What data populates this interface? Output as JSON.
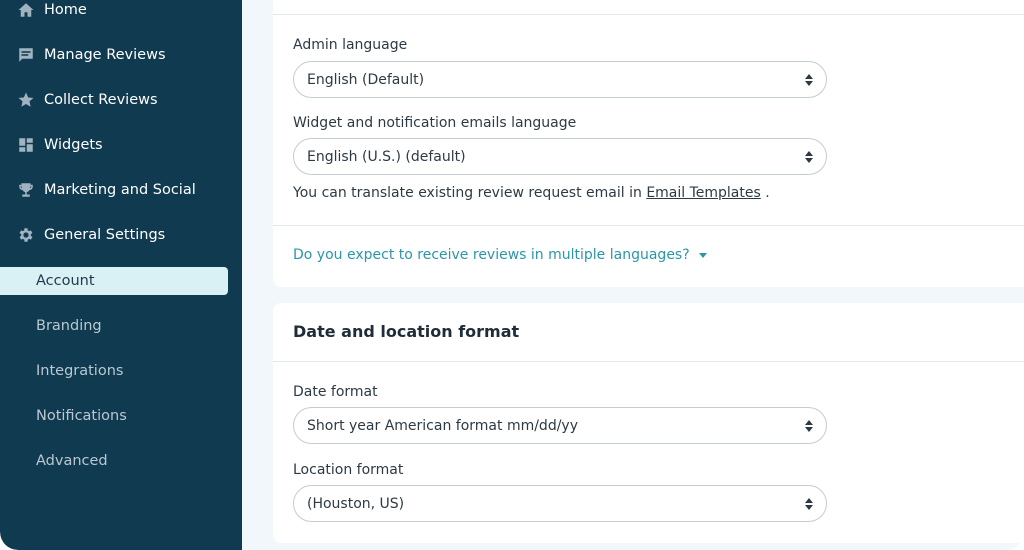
{
  "sidebar": {
    "items": [
      {
        "label": "Home",
        "icon": "home-icon"
      },
      {
        "label": "Manage Reviews",
        "icon": "message-icon"
      },
      {
        "label": "Collect Reviews",
        "icon": "star-icon"
      },
      {
        "label": "Widgets",
        "icon": "widgets-icon"
      },
      {
        "label": "Marketing and Social",
        "icon": "trophy-icon"
      },
      {
        "label": "General Settings",
        "icon": "gear-icon"
      }
    ],
    "sub_items": [
      {
        "label": "Account",
        "active": true
      },
      {
        "label": "Branding",
        "active": false
      },
      {
        "label": "Integrations",
        "active": false
      },
      {
        "label": "Notifications",
        "active": false
      },
      {
        "label": "Advanced",
        "active": false
      }
    ]
  },
  "language": {
    "admin_label": "Admin language",
    "admin_value": "English (Default)",
    "widget_label": "Widget and notification emails language",
    "widget_value": "English (U.S.) (default)",
    "helper_text": "You can translate existing review request email in",
    "helper_link": "Email Templates",
    "helper_end": ".",
    "question": "Do you expect to receive reviews in multiple languages?"
  },
  "format": {
    "title": "Date and location format",
    "date_label": "Date format",
    "date_value": "Short year American format mm/dd/yy",
    "location_label": "Location format",
    "location_value": "(Houston, US)"
  },
  "colors": {
    "sidebar_bg": "#0f3a50",
    "active_bg": "#d9f0f5",
    "link_accent": "#2a97a8",
    "page_bg": "#f2f7fb"
  }
}
